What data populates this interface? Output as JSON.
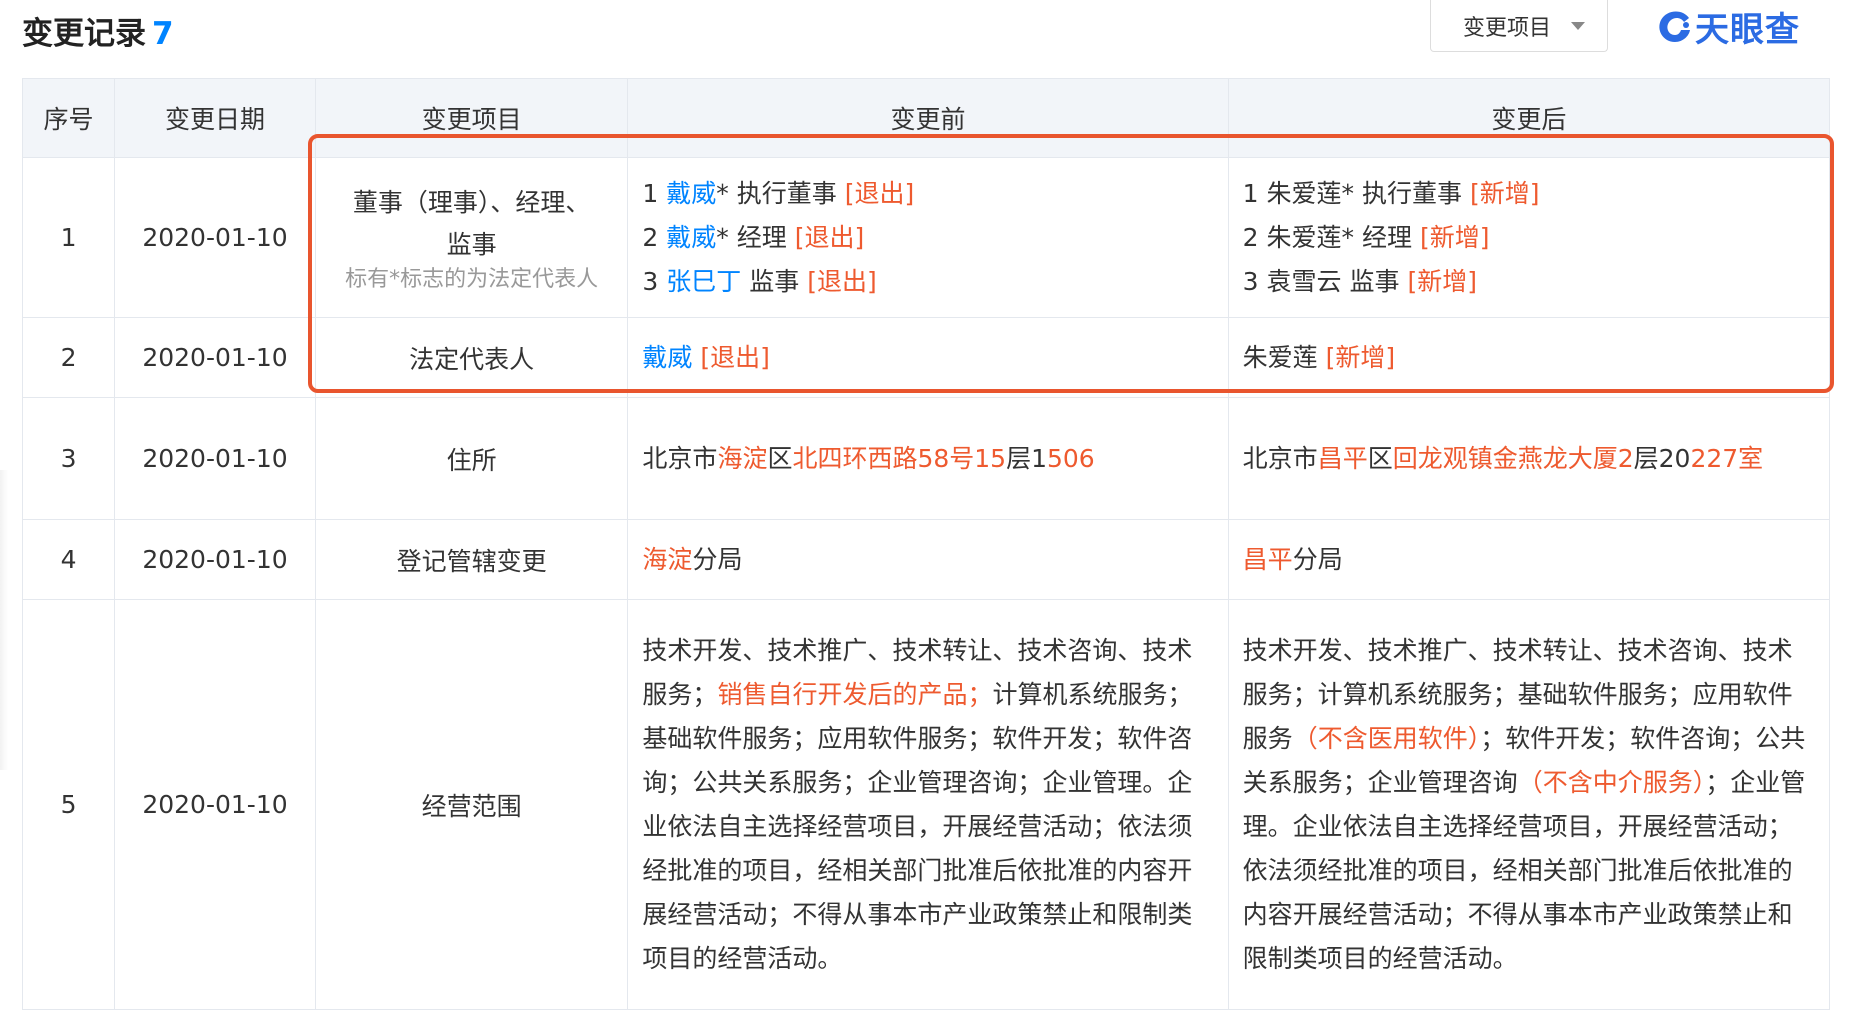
{
  "header": {
    "title": "变更记录",
    "count": "7",
    "filter_label": "变更项目",
    "logo_text": "天眼查"
  },
  "table": {
    "columns": [
      "序号",
      "变更日期",
      "变更项目",
      "变更前",
      "变更后"
    ],
    "rows": [
      {
        "index": "1",
        "date": "2020-01-10",
        "item": "董事（理事）、经理、监事",
        "item_note": "标有*标志的为法定代表人",
        "before": [
          {
            "num": "1",
            "name": "戴威",
            "role": "* 执行董事",
            "tag": "[退出]"
          },
          {
            "num": "2",
            "name": "戴威",
            "role": "* 经理",
            "tag": "[退出]"
          },
          {
            "num": "3",
            "name": "张巳丁",
            "role": " 监事",
            "tag": "[退出]"
          }
        ],
        "after": [
          {
            "num": "1",
            "name": "朱爱莲",
            "role": "* 执行董事",
            "tag": "[新增]"
          },
          {
            "num": "2",
            "name": "朱爱莲",
            "role": "* 经理",
            "tag": "[新增]"
          },
          {
            "num": "3",
            "name": "袁雪云",
            "role": " 监事",
            "tag": "[新增]"
          }
        ]
      },
      {
        "index": "2",
        "date": "2020-01-10",
        "item": "法定代表人",
        "before": {
          "name": "戴威",
          "tag": "[退出]"
        },
        "after": {
          "name": "朱爱莲",
          "tag": "[新增]"
        }
      },
      {
        "index": "3",
        "date": "2020-01-10",
        "item": "住所",
        "before_parts": [
          {
            "t": "北京市",
            "hl": false
          },
          {
            "t": "海淀",
            "hl": true
          },
          {
            "t": "区",
            "hl": false
          },
          {
            "t": "北四环西路58号15",
            "hl": true
          },
          {
            "t": "层1",
            "hl": false
          },
          {
            "t": "506",
            "hl": true
          }
        ],
        "after_parts": [
          {
            "t": "北京市",
            "hl": false
          },
          {
            "t": "昌平",
            "hl": true
          },
          {
            "t": "区",
            "hl": false
          },
          {
            "t": "回龙观镇金燕龙大厦2",
            "hl": true
          },
          {
            "t": "层2",
            "hl": false
          },
          {
            "t": "0",
            "hl": false
          },
          {
            "t": "227室",
            "hl": true
          }
        ]
      },
      {
        "index": "4",
        "date": "2020-01-10",
        "item": "登记管辖变更",
        "before_parts": [
          {
            "t": "海淀",
            "hl": true
          },
          {
            "t": "分局",
            "hl": false
          }
        ],
        "after_parts": [
          {
            "t": "昌平",
            "hl": true
          },
          {
            "t": "分局",
            "hl": false
          }
        ]
      },
      {
        "index": "5",
        "date": "2020-01-10",
        "item": "经营范围",
        "before_parts": [
          {
            "t": "技术开发、技术推广、技术转让、技术咨询、技术服务；",
            "hl": false
          },
          {
            "t": "销售自行开发后的产品；",
            "hl": true
          },
          {
            "t": "计算机系统服务；基础软件服务；应用软件服务；软件开发；软件咨询；公共关系服务；企业管理咨询；企业管理。企业依法自主选择经营项目，开展经营活动；依法须经批准的项目，经相关部门批准后依批准的内容开展经营活动；不得从事本市产业政策禁止和限制类项目的经营活动。",
            "hl": false
          }
        ],
        "after_parts": [
          {
            "t": "技术开发、技术推广、技术转让、技术咨询、技术服务；计算机系统服务；基础软件服务；应用软件服务",
            "hl": false
          },
          {
            "t": "（不含医用软件）",
            "hl": true
          },
          {
            "t": "；软件开发；软件咨询；公共关系服务；企业管理咨询",
            "hl": false
          },
          {
            "t": "（不含中介服务）",
            "hl": true
          },
          {
            "t": "；企业管理。企业依法自主选择经营项目，开展经营活动；依法须经批准的项目，经相关部门批准后依批准的内容开展经营活动；不得从事本市产业政策禁止和限制类项目的经营活动。",
            "hl": false
          }
        ]
      }
    ]
  },
  "colors": {
    "accent": "#0084ff",
    "change_highlight": "#ee5a2f",
    "annotation_box": "#e9552e",
    "header_bg": "#f2f5f9"
  }
}
